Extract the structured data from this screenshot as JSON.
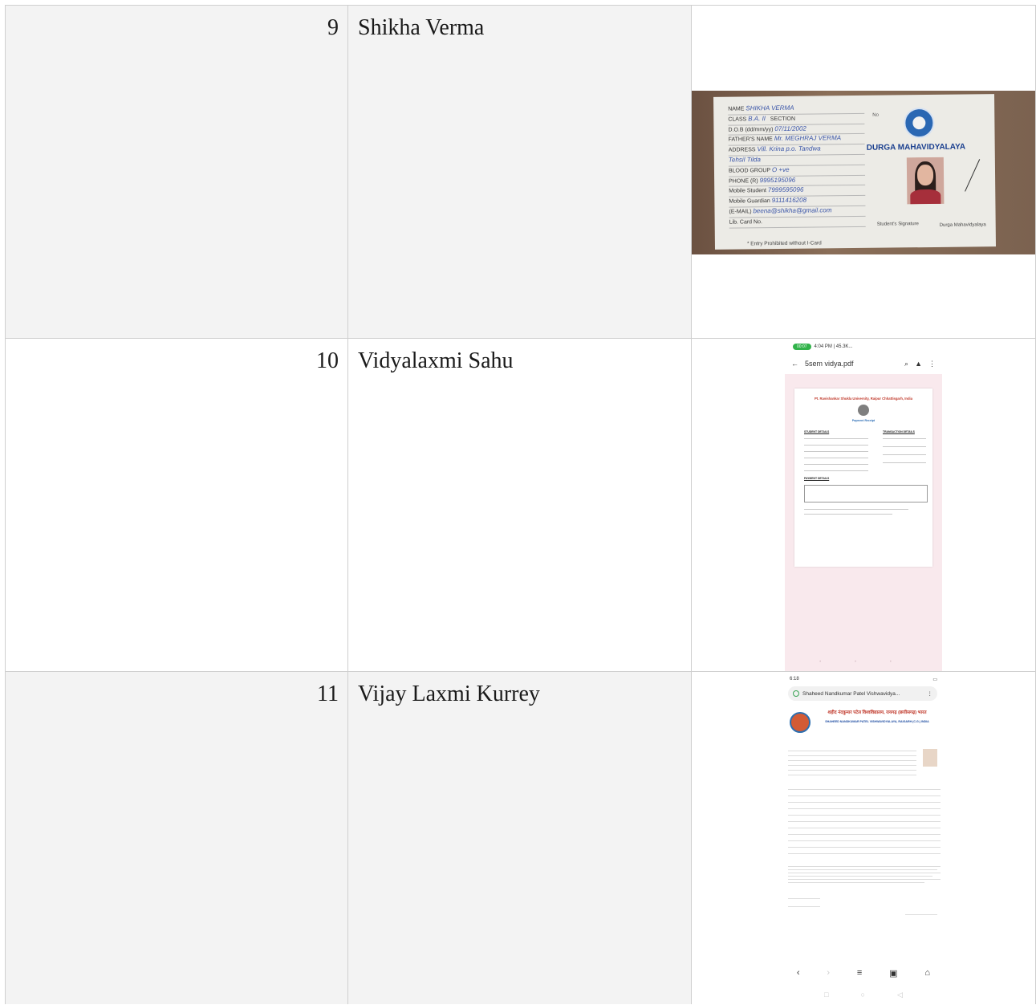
{
  "rows": [
    {
      "number": "9",
      "name": "Shikha Verma",
      "image": {
        "kind": "id-card-photo",
        "fields": [
          {
            "label": "NAME",
            "value": "SHIKHA VERMA"
          },
          {
            "label": "CLASS",
            "value": "B.A. II"
          },
          {
            "label": "D.O.B (dd/mm/yy)",
            "value": "07/11/2002"
          },
          {
            "label": "FATHER'S NAME",
            "value": "Mr. MEGHRAJ VERMA"
          },
          {
            "label": "ADDRESS",
            "value": "Vill. Krina p.o. Tandwa"
          },
          {
            "label": "",
            "value": "Tehsil Tilda"
          },
          {
            "label": "BLOOD GROUP",
            "value": "O +ve"
          },
          {
            "label": "PHONE (R)",
            "value": "9995195096"
          },
          {
            "label": "Mobile Student",
            "value": "7999595096"
          },
          {
            "label": "Mobile Guardian",
            "value": "9111416208"
          },
          {
            "label": "(E-MAIL)",
            "value": "beena@shikha@gmail.com"
          },
          {
            "label": "Lib. Card No.",
            "value": ""
          }
        ],
        "section_label": "SECTION",
        "no_label": "No",
        "college": "DURGA MAHAVIDYALAYA",
        "student_signature": "Student's Signature",
        "principal": "Durga Mahavidyalaya",
        "footer": "* Entry Prohibited without I-Card"
      }
    },
    {
      "number": "10",
      "name": "Vidyalaxmi Sahu",
      "image": {
        "kind": "phone-screenshot-pdf",
        "status_time": "4:04 PM | 45.3K...",
        "call_pill": "00:07",
        "file_title": "5sem vidya.pdf",
        "receipt_title": "Pt. Ravishankar Shukla University, Raipur Chhattisgarh, India",
        "receipt_subtitle": "Payment Receipt",
        "student_details": "STUDENT DETAILS",
        "transaction_details": "TRANSACTION DETAILS",
        "payment_details": "PAYMENT DETAILS"
      }
    },
    {
      "number": "11",
      "name": "Vijay Laxmi Kurrey",
      "image": {
        "kind": "phone-screenshot-browser",
        "status_time": "6:18",
        "url_text": "Shaheed Nandkumar Patel Vishwavidya...",
        "university_hindi": "शहीद नंदकुमार पटेल विश्वविद्यालय, रायगढ़ (छत्तीसगढ़) भारत",
        "university_english": "SHAHEED NANDKUMAR PATEL VISHWAVIDYALAYA, RAIGARH (C.G.) INDIA"
      }
    }
  ],
  "colors": {
    "cell_shade": "#f3f3f3",
    "border": "#cfcfcf",
    "receipt_red": "#c0392b",
    "call_green": "#31b34a"
  }
}
